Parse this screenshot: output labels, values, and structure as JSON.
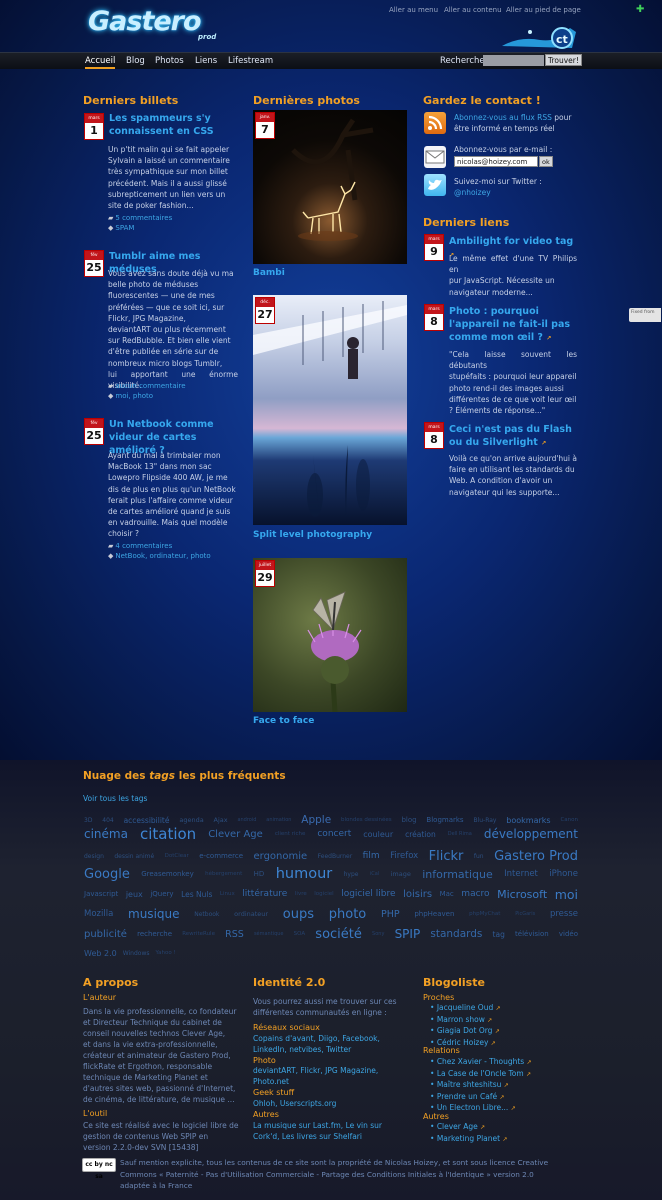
{
  "header": {
    "logo": "Gastero",
    "logo_sub": "prod",
    "skip_menu": "Aller au menu",
    "skip_content": "Aller au contenu",
    "skip_footer": "Aller au pied de page",
    "plus": "✚"
  },
  "nav": {
    "items": [
      "Accueil",
      "Blog",
      "Photos",
      "Liens",
      "Lifestream"
    ],
    "search_label": "Recherche",
    "search_button": "Trouver!"
  },
  "billets": {
    "title": "Derniers billets",
    "posts": [
      {
        "month": "mars 2010",
        "day": "1",
        "title": "Les spammeurs s'y connaissent en CSS",
        "lines": [
          "Un p'tit malin qui se fait appeler",
          "Sylvain a laissé un commentaire",
          "très sympathique sur mon billet",
          "précédent. Mais il a aussi glissé",
          "subrepticement un lien vers un",
          "site de poker fashion..."
        ],
        "comments": "5 commentaires",
        "tags": "SPAM"
      },
      {
        "month": "fév 2010",
        "day": "25",
        "title": "Tumblr aime mes méduses",
        "lines": [
          "Vous avez sans doute déjà vu ma",
          "belle photo de méduses",
          "fluorescentes — une de mes",
          "préférées — que ce soit ici, sur",
          "Flickr, JPG Magazine,",
          "deviantART ou plus récemment",
          "sur RedBubble. Et bien elle vient",
          "d'être publiée en série sur de",
          "nombreux micro blogs Tumblr,",
          "lui apportant une énorme visibilité."
        ],
        "comments": "aucun commentaire",
        "tags": "moi, photo"
      },
      {
        "month": "fév 2010",
        "day": "25",
        "title": "Un Netbook comme videur de cartes amélioré ?",
        "lines": [
          "Ayant du mal à trimbaler mon",
          "MacBook 13\" dans mon sac",
          "Lowepro Flipside 400 AW, je me",
          "dis de plus en plus qu'un NetBook",
          "ferait plus l'affaire comme videur",
          "de cartes amélioré quand je suis",
          "en vadrouille. Mais quel modèle",
          "choisir ?"
        ],
        "comments": "4 commentaires",
        "tags": "NetBook, ordinateur, photo"
      }
    ]
  },
  "photos": {
    "title": "Dernières photos",
    "items": [
      {
        "month": "janv. 2010",
        "day": "7",
        "caption": "Bambi"
      },
      {
        "month": "déc. 2009",
        "day": "27",
        "caption": "Split level photography"
      },
      {
        "month": "juillet 2009",
        "day": "29",
        "caption": "Face to face"
      }
    ]
  },
  "contact": {
    "title": "Gardez le contact !",
    "rss_link": "Abonnez-vous au flux RSS",
    "rss_rest": " pour être informé en temps réel",
    "mail_text": "Abonnez-vous par e-mail :",
    "mail_value": "nicolas@hoizey.com",
    "mail_ok": "ok",
    "twitter_text": "Suivez-moi sur Twitter :",
    "twitter_handle": "@nhoizey"
  },
  "liens": {
    "title": "Derniers liens",
    "items": [
      {
        "month": "mars 2010",
        "day": "9",
        "title": "Ambilight for video tag",
        "lines": [
          "Le même effet d'une TV Philips en",
          "pur JavaScript. Nécessite un",
          "navigateur moderne..."
        ]
      },
      {
        "month": "mars 2010",
        "day": "8",
        "title": "Photo : pourquoi l'appareil ne fait-il pas comme mon œil ?",
        "lines": [
          "\"Cela laisse souvent les débutants",
          "stupéfaits : pourquoi leur appareil",
          "photo rend-il des images aussi",
          "différentes de ce que voit leur œil",
          "? Éléments de réponse...\""
        ]
      },
      {
        "month": "mars 2010",
        "day": "8",
        "title": "Ceci n'est pas du Flash ou du Silverlight",
        "lines": [
          "Voilà ce qu'on arrive aujourd'hui à",
          "faire en utilisant les standards du",
          "Web. A condition d'avoir un",
          "navigateur qui les supporte..."
        ]
      }
    ]
  },
  "side_tab": "Fixed from",
  "tags": {
    "title_a": "Nuage des ",
    "title_em": "tags",
    "title_b": " les plus fréquents",
    "see_all": "Voir tous les tags"
  },
  "tag_rows": [
    [
      [
        "3D",
        6,
        "#2c4e7e"
      ],
      [
        "404",
        6,
        "#2c4e7e"
      ],
      [
        "accessibilité",
        7.5,
        "#2f5a94"
      ],
      [
        "agenda",
        6.5,
        "#2c4e7e"
      ],
      [
        "Ajax",
        6.5,
        "#2c4e7e"
      ],
      [
        "android",
        5,
        "#25406a"
      ],
      [
        "animation",
        5,
        "#25406a"
      ],
      [
        "Apple",
        10.5,
        "#3a6bb0"
      ],
      [
        "blondes dessinées",
        5.5,
        "#25406a"
      ],
      [
        "blog",
        7,
        "#2c4e7e"
      ],
      [
        "Blogmarks",
        7,
        "#2f5a94"
      ],
      [
        "Blu-Ray",
        6,
        "#2c4e7e"
      ],
      [
        "bookmarks",
        8,
        "#3468a8"
      ],
      [
        "Canon",
        5.5,
        "#25406a"
      ]
    ],
    [
      [
        "cinéma",
        12,
        "#3a7ac4"
      ],
      [
        "citation",
        15,
        "#3e86d4"
      ],
      [
        "Clever Age",
        10,
        "#3468a8"
      ],
      [
        "client riche",
        5.5,
        "#25406a"
      ],
      [
        "concert",
        9,
        "#3468a8"
      ],
      [
        "couleur",
        8,
        "#2f5a94"
      ],
      [
        "création",
        7.5,
        "#2f5a94"
      ],
      [
        "Dell Rima",
        5,
        "#25406a"
      ],
      [
        "développement",
        12,
        "#3a7ac4"
      ]
    ],
    [
      [
        "design",
        6,
        "#2c4e7e"
      ],
      [
        "dessin animé",
        6,
        "#2c4e7e"
      ],
      [
        "DotClear",
        5.5,
        "#25406a"
      ],
      [
        "e-commerce",
        7,
        "#2f5a94"
      ],
      [
        "ergonomie",
        10,
        "#3468a8"
      ],
      [
        "FeedBurner",
        6,
        "#2c4e7e"
      ],
      [
        "film",
        9,
        "#3468a8"
      ],
      [
        "Firefox",
        8.5,
        "#2f5a94"
      ],
      [
        "Flickr",
        13,
        "#3a7ac4"
      ],
      [
        "fun",
        6,
        "#2c4e7e"
      ],
      [
        "Gastero Prod",
        13,
        "#3a7ac4"
      ]
    ],
    [
      [
        "Google",
        13,
        "#3a7ac4"
      ],
      [
        "Greasemonkey",
        7,
        "#2f5a94"
      ],
      [
        "hébergement",
        5.5,
        "#25406a"
      ],
      [
        "HD",
        7,
        "#2c4e7e"
      ],
      [
        "humour",
        14.5,
        "#3e86d4"
      ],
      [
        "hype",
        6,
        "#2c4e7e"
      ],
      [
        "iCal",
        5,
        "#25406a"
      ],
      [
        "image",
        6.5,
        "#2c4e7e"
      ],
      [
        "informatique",
        11,
        "#3468a8"
      ],
      [
        "Internet",
        8.5,
        "#2f5a94"
      ],
      [
        "iPhone",
        8.5,
        "#2f5a94"
      ]
    ],
    [
      [
        "Javascript",
        7,
        "#2f5a94"
      ],
      [
        "jeux",
        8,
        "#2f5a94"
      ],
      [
        "jQuery",
        7,
        "#2f5a94"
      ],
      [
        "Les Nuls",
        7.5,
        "#2f5a94"
      ],
      [
        "Linux",
        5.5,
        "#25406a"
      ],
      [
        "littérature",
        9,
        "#3468a8"
      ],
      [
        "livre",
        5.5,
        "#25406a"
      ],
      [
        "logiciel",
        5.5,
        "#25406a"
      ],
      [
        "logiciel libre",
        9,
        "#3468a8"
      ],
      [
        "loisirs",
        10,
        "#3468a8"
      ],
      [
        "Mac",
        7,
        "#2f5a94"
      ],
      [
        "macro",
        9,
        "#3468a8"
      ],
      [
        "Microsoft",
        11,
        "#3a7ac4"
      ],
      [
        "moi",
        12.5,
        "#3a7ac4"
      ]
    ],
    [
      [
        "Mozilla",
        8.5,
        "#2f5a94"
      ],
      [
        "musique",
        12,
        "#3a7ac4"
      ],
      [
        "Netbook",
        6,
        "#2c4e7e"
      ],
      [
        "ordinateur",
        6.5,
        "#2c4e7e"
      ],
      [
        "oups",
        13,
        "#3a7ac4"
      ],
      [
        "photo",
        13,
        "#3a7ac4"
      ],
      [
        "PHP",
        9.5,
        "#3468a8"
      ],
      [
        "phpHeaven",
        7,
        "#2f5a94"
      ],
      [
        "phpMyChat",
        5.5,
        "#25406a"
      ],
      [
        "PicGaris",
        5,
        "#25406a"
      ],
      [
        "presse",
        8.5,
        "#2f5a94"
      ]
    ],
    [
      [
        "publicité",
        10,
        "#3468a8"
      ],
      [
        "recherche",
        7,
        "#2f5a94"
      ],
      [
        "RewriteRule",
        5.5,
        "#25406a"
      ],
      [
        "RSS",
        9.5,
        "#3468a8"
      ],
      [
        "sémantique",
        5,
        "#25406a"
      ],
      [
        "SOA",
        5.5,
        "#25406a"
      ],
      [
        "société",
        13,
        "#3a7ac4"
      ],
      [
        "Sony",
        5,
        "#25406a"
      ],
      [
        "SPIP",
        12,
        "#3a7ac4"
      ],
      [
        "standards",
        10.5,
        "#3468a8"
      ],
      [
        "tag",
        7.5,
        "#2f5a94"
      ],
      [
        "télévision",
        7,
        "#2f5a94"
      ],
      [
        "vidéo",
        7,
        "#2f5a94"
      ]
    ],
    [
      [
        "Web 2.0",
        8,
        "#2f5a94"
      ],
      [
        "Windows",
        6,
        "#2c4e7e"
      ],
      [
        "Yahoo !",
        5.5,
        "#25406a"
      ]
    ]
  ],
  "apropos": {
    "title": "A propos",
    "auteur": "L'auteur",
    "auteur_lines": [
      "Dans la vie professionnelle, co fondateur",
      "et Directeur Technique du cabinet de",
      "conseil nouvelles technos Clever Age,",
      "et dans la vie extra-professionnelle,",
      "créateur et animateur de Gastero Prod,",
      "flickRate et Ergothon, responsable",
      "technique de Marketing Planet et",
      "d'autres sites web, passionné d'Internet,",
      "de cinéma, de littérature, de musique ..."
    ],
    "outil": "L'outil",
    "outil_lines": [
      "Ce site est réalisé avec le logiciel libre de",
      "gestion de contenus Web SPIP en",
      "version 2.2.0-dev SVN [15438]"
    ]
  },
  "identite": {
    "title": "Identité 2.0",
    "intro": [
      "Vous pourrez aussi me trouver sur ces",
      "différentes communautés en ligne :"
    ],
    "groups": [
      {
        "label": "Réseaux sociaux",
        "lines": [
          "Copains d'avant, Diigo, Facebook,",
          "LinkedIn, netvibes, Twitter"
        ]
      },
      {
        "label": "Photo",
        "lines": [
          "deviantART, Flickr, JPG Magazine,",
          "Photo.net"
        ]
      },
      {
        "label": "Geek stuff",
        "lines": [
          "Ohloh, Userscripts.org"
        ]
      },
      {
        "label": "Autres",
        "lines": [
          "La musique sur Last.fm, Le vin sur",
          "Cork'd, Les livres sur Shelfari"
        ]
      }
    ]
  },
  "blogoliste": {
    "title": "Blogoliste",
    "groups": [
      {
        "label": "Proches",
        "items": [
          "Jacqueline Oud",
          "Marron show",
          "Giagia Dot Org",
          "Cédric Hoizey"
        ]
      },
      {
        "label": "Relations",
        "items": [
          "Chez Xavier - Thoughts",
          "La Case de l'Oncle Tom",
          "Maître shteshitsu",
          "Prendre un Café",
          "Un Electron Libre..."
        ]
      },
      {
        "label": "Autres",
        "items": [
          "Clever Age",
          "Marketing Planet"
        ]
      }
    ]
  },
  "license": {
    "badge": "cc by nc sa",
    "lines": [
      "Sauf mention explicite, tous les contenus de ce site sont la propriété de Nicolas Hoizey, et sont sous licence Creative",
      "Commons « Paternité - Pas d'Utilisation Commerciale - Partage des Conditions Initiales à l'Identique » version 2.0",
      "adaptée à la France"
    ]
  }
}
